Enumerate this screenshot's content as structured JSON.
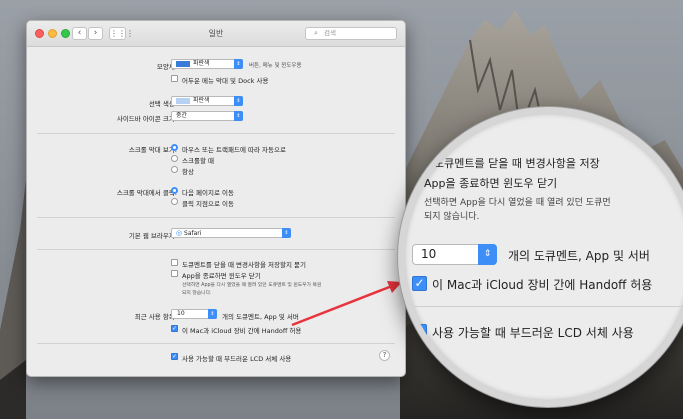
{
  "window": {
    "title": "일반",
    "search_placeholder": "검색",
    "back_label": "‹",
    "forward_label": "›"
  },
  "appearance": {
    "label": "모양새:",
    "value": "파란색",
    "hint": "버튼, 메뉴 및 윈도우용",
    "dark_menu_checkbox": "어두운 메뉴 막대 및 Dock 사용"
  },
  "highlight": {
    "label": "선택 색상:",
    "value": "파란색"
  },
  "sidebar_icon": {
    "label": "사이드바 아이콘 크기:",
    "value": "중간"
  },
  "scrollbars": {
    "label": "스크롤 막대 보기:",
    "options": [
      "마우스 또는 트랙패드에 따라 자동으로",
      "스크롤할 때",
      "항상"
    ],
    "selected_index": 0
  },
  "scroll_click": {
    "label": "스크롤 막대에서 클릭:",
    "options": [
      "다음 페이지로 이동",
      "클릭 지점으로 이동"
    ],
    "selected_index": 0
  },
  "browser": {
    "label": "기본 웹 브라우저:",
    "value": "Safari"
  },
  "documents": {
    "ask_save": "도큐멘트를 닫을 때 변경사항을 저장할지 묻기",
    "close_windows": "App을 종료하면 윈도우 닫기",
    "note_line1": "선택하면 App을 다시 열었을 때 열려 있던 도큐멘트 및 윈도우가 복원",
    "note_line2": "되지 않습니다."
  },
  "recent": {
    "label": "최근 사용 항목:",
    "value": "10",
    "suffix": "개의 도큐멘트, App 및 서버",
    "handoff": "이 Mac과 iCloud 장비 간에 Handoff 허용"
  },
  "lcd": {
    "label": "사용 가능할 때 부드러운 LCD 서체 사용"
  },
  "magnifier": {
    "line1": "도큐멘트를 닫을 때 변경사항을 저장",
    "line2": "App을 종료하면 윈도우 닫기",
    "line3": "선택하면 App을 다시 열었을 때 열려 있던 도큐먼",
    "line4": "되지 않습니다.",
    "stepper_value": "10",
    "recent_suffix": "개의 도큐멘트, App 및 서버",
    "handoff": "이 Mac과 iCloud 장비 간에 Handoff 허용",
    "lcd": "사용 가능할 때 부드러운 LCD 서체 사용"
  },
  "colors": {
    "accent": "#3e8ef7",
    "pointer": "#e8343c"
  }
}
